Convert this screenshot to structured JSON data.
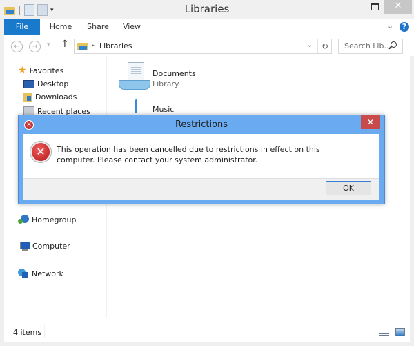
{
  "window": {
    "title": "Libraries",
    "controls": {
      "minimize": "–",
      "maximize": "☐",
      "close": "✕"
    }
  },
  "ribbon": {
    "tabs": [
      {
        "label": "File",
        "active": true
      },
      {
        "label": "Home"
      },
      {
        "label": "Share"
      },
      {
        "label": "View"
      }
    ],
    "expand_icon": "⌄",
    "help_icon": "?"
  },
  "navigation": {
    "back_icon": "←",
    "forward_icon": "→",
    "recent_icon": "▾",
    "up_icon": "↑",
    "address": {
      "separator_icon": "▸",
      "path": "Libraries",
      "dropdown_icon": "⌄",
      "refresh_icon": "↻"
    },
    "search": {
      "placeholder": "Search Lib..."
    }
  },
  "sidebar": {
    "favorites": {
      "label": "Favorites",
      "icon": "★"
    },
    "items": [
      {
        "label": "Desktop",
        "icon": "desktop-icon"
      },
      {
        "label": "Downloads",
        "icon": "downloads-icon"
      },
      {
        "label": "Recent places",
        "icon": "recent-places-icon"
      }
    ],
    "groups": [
      {
        "label": "Homegroup",
        "icon": "homegroup-icon"
      },
      {
        "label": "Computer",
        "icon": "computer-icon"
      },
      {
        "label": "Network",
        "icon": "network-icon"
      }
    ]
  },
  "libraries": [
    {
      "name": "Documents",
      "type": "Library"
    },
    {
      "name": "Music",
      "type": ""
    }
  ],
  "status": {
    "items": "4 items"
  },
  "dialog": {
    "title": "Restrictions",
    "title_icon": "✕",
    "close_icon": "✕",
    "error_icon": "✕",
    "message": "This operation has been cancelled due to restrictions in effect on this computer. Please contact your system administrator.",
    "ok_label": "OK"
  }
}
